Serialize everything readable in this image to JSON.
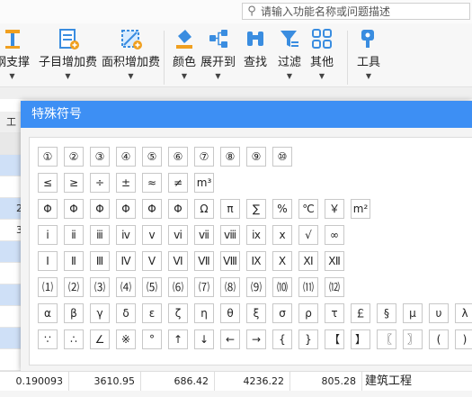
{
  "search": {
    "placeholder": "请输入功能名称或问题描述"
  },
  "ribbon": {
    "items": [
      {
        "label": "钢支撑",
        "icon": "steel-support-icon"
      },
      {
        "label": "子目增加费",
        "icon": "sub-item-add-fee-icon"
      },
      {
        "label": "面积增加费",
        "icon": "area-add-fee-icon"
      },
      {
        "label": "颜色",
        "icon": "paint-bucket-icon"
      },
      {
        "label": "展开到",
        "icon": "expand-tree-icon"
      },
      {
        "label": "查找",
        "icon": "binoculars-icon"
      },
      {
        "label": "过滤",
        "icon": "filter-icon"
      },
      {
        "label": "其他",
        "icon": "grid-apps-icon"
      },
      {
        "label": "工具",
        "icon": "wrench-icon"
      }
    ]
  },
  "grid": {
    "header_fragment": "工",
    "left_values": [
      "2",
      "3"
    ],
    "row": {
      "values": [
        "0.190093",
        "3610.95",
        "686.42",
        "4236.22",
        "805.28"
      ],
      "text": "建筑工程"
    }
  },
  "dialog": {
    "title": "特殊符号",
    "rows": [
      [
        "①",
        "②",
        "③",
        "④",
        "⑤",
        "⑥",
        "⑦",
        "⑧",
        "⑨",
        "⑩"
      ],
      [
        "≤",
        "≥",
        "÷",
        "±",
        "≈",
        "≠",
        "m³"
      ],
      [
        "Φ",
        "Φ",
        "Φ",
        "Φ",
        "Φ",
        "Φ",
        "Ω",
        "π",
        "∑",
        "%",
        "℃",
        "￥",
        "m²"
      ],
      [
        "ⅰ",
        "ⅱ",
        "ⅲ",
        "ⅳ",
        "ⅴ",
        "ⅵ",
        "ⅶ",
        "ⅷ",
        "ⅸ",
        "ⅹ",
        "√",
        "∞"
      ],
      [
        "Ⅰ",
        "Ⅱ",
        "Ⅲ",
        "Ⅳ",
        "Ⅴ",
        "Ⅵ",
        "Ⅶ",
        "Ⅷ",
        "Ⅸ",
        "Ⅹ",
        "Ⅺ",
        "Ⅻ"
      ],
      [
        "⑴",
        "⑵",
        "⑶",
        "⑷",
        "⑸",
        "⑹",
        "⑺",
        "⑻",
        "⑼",
        "⑽",
        "⑾",
        "⑿"
      ],
      [
        "α",
        "β",
        "γ",
        "δ",
        "ε",
        "ζ",
        "η",
        "θ",
        "ξ",
        "σ",
        "ρ",
        "τ",
        "￡",
        "§",
        "μ",
        "υ",
        "λ"
      ],
      [
        "∵",
        "∴",
        "∠",
        "※",
        "°",
        "↑",
        "↓",
        "←",
        "→",
        "{",
        "}",
        "【",
        "】",
        "〖",
        "〗",
        "(",
        ")"
      ]
    ]
  },
  "colors": {
    "accent": "#3d8ff4",
    "selected_row": "#cfe0f7"
  }
}
